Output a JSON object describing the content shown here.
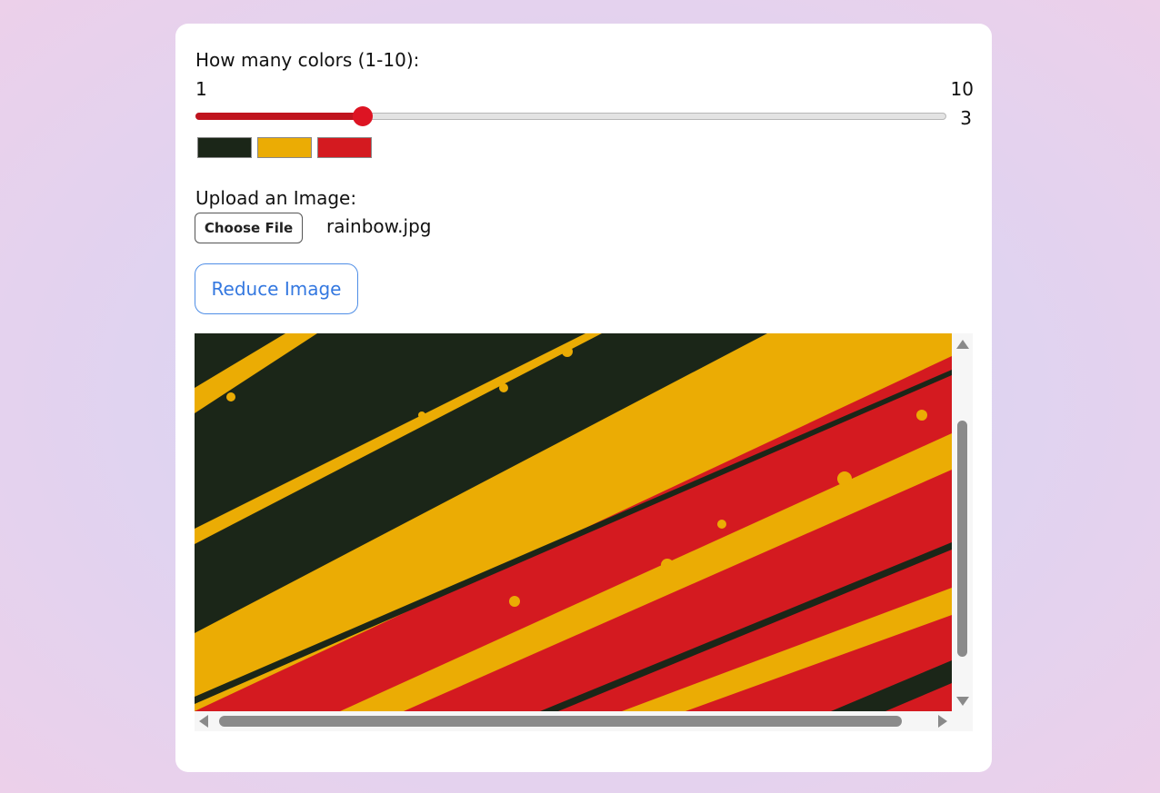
{
  "colors_control": {
    "label": "How many colors (1-10):",
    "min_label": "1",
    "max_label": "10",
    "min": 1,
    "max": 10,
    "value": 3,
    "value_label": "3"
  },
  "palette": [
    "#1b2618",
    "#ebac04",
    "#d41a20"
  ],
  "upload": {
    "label": "Upload an Image:",
    "button_label": "Choose File",
    "file_name": "rainbow.jpg"
  },
  "reduce_button": {
    "label": "Reduce Image"
  },
  "result_image": {
    "colors": {
      "dark": "#1b2618",
      "yellow": "#ebac04",
      "red": "#d41a20"
    }
  }
}
